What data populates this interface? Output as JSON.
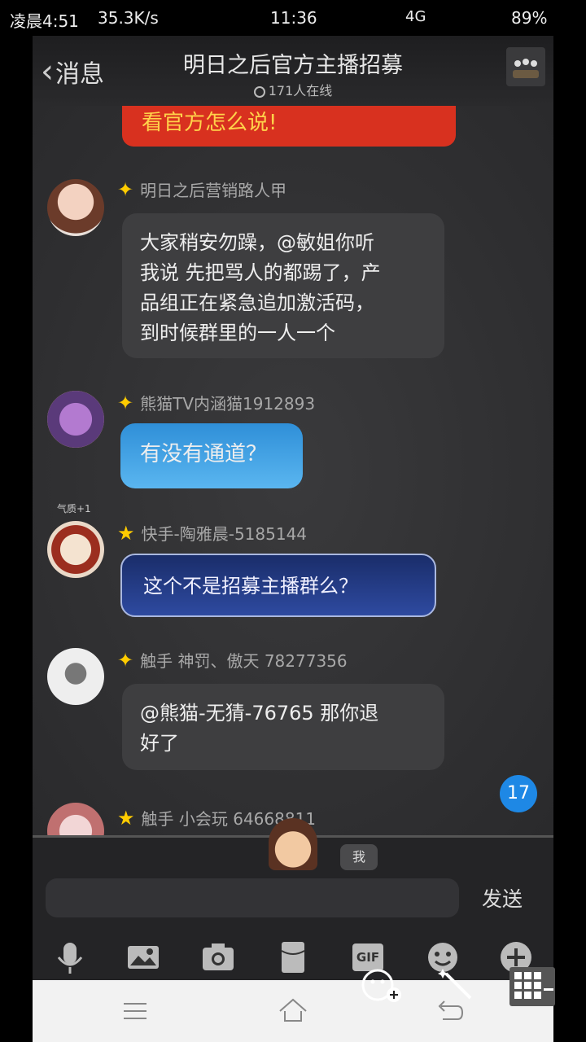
{
  "status_bar": {
    "time": "11:36",
    "speed": "35.3K/s",
    "left_label": "凌晨4:51",
    "signal": "4G",
    "battery": "89%"
  },
  "header": {
    "back_label": "消息",
    "title": "明日之后官方主播招募",
    "online": "171人在线"
  },
  "messages": [
    {
      "sender": "明日之后营销路人甲",
      "text_lines": [
        "大家稍安勿躁，@敏姐你听",
        "我说 先把骂人的都踢了，产",
        "品组正在紧急追加激活码，",
        "到时候群里的一人一个"
      ]
    },
    {
      "sender": "熊猫TV内涵猫1912893",
      "text": "有没有通道？"
    },
    {
      "sender": "快手-陶雅晨-5185144",
      "text": "这个不是招募主播群么？",
      "badge": "气质+1"
    },
    {
      "sender": "触手 神罚、傲天 78277356",
      "text_lines": [
        "@熊猫-无猜-76765 那你退",
        "好了"
      ]
    },
    {
      "sender": "触手 小会玩 64668811"
    }
  ],
  "top_bubble_text": "看官方怎么说!",
  "unread_count": "17",
  "input": {
    "send_label": "发送",
    "me_label": "我"
  },
  "toolbar": [
    "mic-icon",
    "image-icon",
    "camera-icon",
    "redpacket-icon",
    "gif-icon",
    "emoji-icon",
    "plus-icon"
  ],
  "gif_label": "GIF",
  "colors": {
    "accent": "#1e88e5",
    "red": "#d8311f",
    "gold": "#ffcc00"
  }
}
